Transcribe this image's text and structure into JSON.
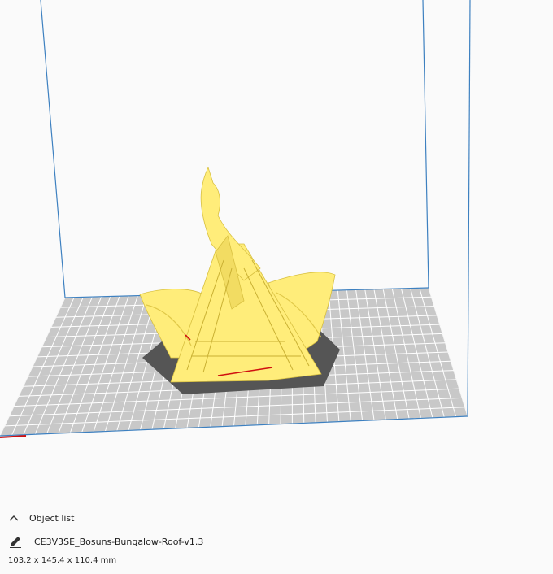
{
  "object_list": {
    "label": "Object list",
    "collapse_icon": "chevron-up-icon"
  },
  "object": {
    "edit_icon": "pencil-icon",
    "name": "CE3V3SE_Bosuns-Bungalow-Roof-v1.3",
    "dimensions": "103.2 x 145.4 x 110.4 mm"
  },
  "colors": {
    "background": "#fafafa",
    "build_plate": "#c8c8c8",
    "grid_lines": "#ffffff",
    "build_volume_edge": "#3d80c0",
    "model": "#ffed7a",
    "model_shadow": "#555555",
    "x_axis": "#d01010"
  }
}
